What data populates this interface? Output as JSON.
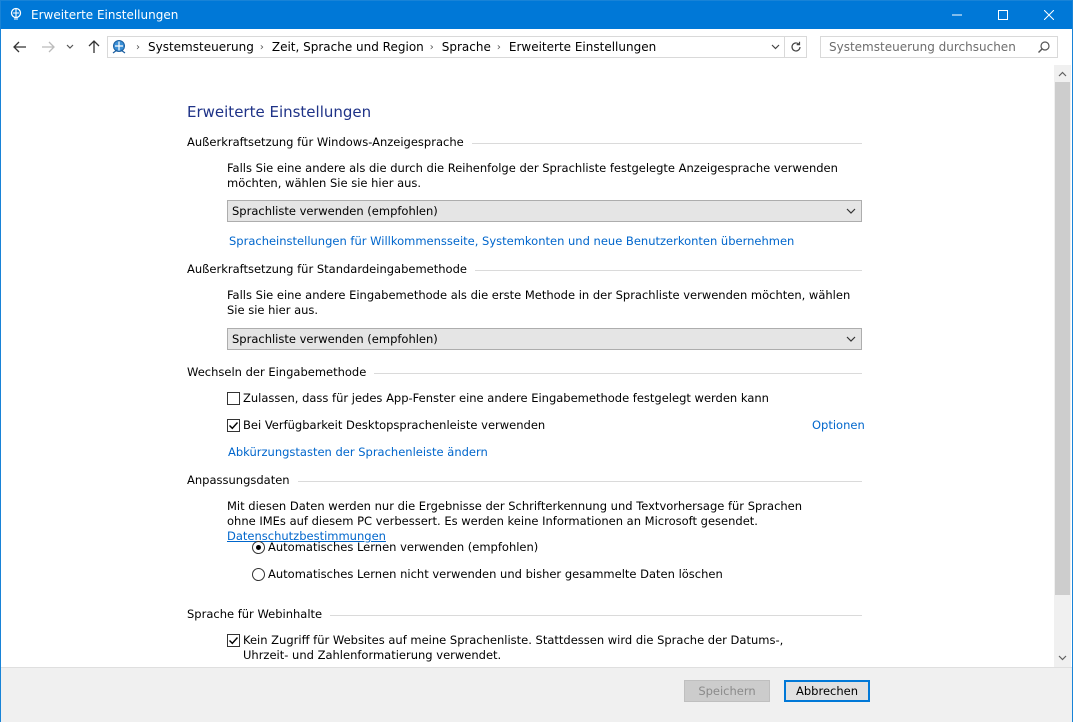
{
  "window": {
    "title": "Erweiterte Einstellungen"
  },
  "address": {
    "breadcrumbs": [
      "Systemsteuerung",
      "Zeit, Sprache und Region",
      "Sprache",
      "Erweiterte Einstellungen"
    ]
  },
  "search": {
    "placeholder": "Systemsteuerung durchsuchen"
  },
  "page": {
    "title": "Erweiterte Einstellungen"
  },
  "display_language": {
    "heading": "Außerkraftsetzung für Windows-Anzeigesprache",
    "description": "Falls Sie eine andere als die durch die Reihenfolge der Sprachliste festgelegte Anzeigesprache verwenden möchten, wählen Sie sie hier aus.",
    "selected": "Sprachliste verwenden (empfohlen)",
    "link": "Spracheinstellungen für Willkommensseite, Systemkonten und neue Benutzerkonten übernehmen"
  },
  "input_method": {
    "heading": "Außerkraftsetzung für Standardeingabemethode",
    "description": "Falls Sie eine andere Eingabemethode als die erste Methode in der Sprachliste verwenden möchten, wählen Sie sie hier aus.",
    "selected": "Sprachliste verwenden (empfohlen)"
  },
  "switching": {
    "heading": "Wechseln der Eingabemethode",
    "per_app_label": "Zulassen, dass für jedes App-Fenster eine andere Eingabemethode festgelegt werden kann",
    "per_app_checked": false,
    "desktop_bar_label": "Bei Verfügbarkeit Desktopsprachenleiste verwenden",
    "desktop_bar_checked": true,
    "options_link": "Optionen",
    "hotkeys_link": "Abkürzungstasten der Sprachenleiste ändern"
  },
  "personalization": {
    "heading": "Anpassungsdaten",
    "description": "Mit diesen Daten werden nur die Ergebnisse der Schrifterkennung und Textvorhersage für Sprachen ohne IMEs auf diesem PC verbessert. Es werden keine Informationen an Microsoft gesendet.",
    "privacy_link": "Datenschutzbestimmungen",
    "radio_use": "Automatisches Lernen verwenden (empfohlen)",
    "radio_dont_use": "Automatisches Lernen nicht verwenden und bisher gesammelte Daten löschen",
    "selected": "use"
  },
  "web_content": {
    "heading": "Sprache für Webinhalte",
    "label": "Kein Zugriff für Websites auf meine Sprachenliste. Stattdessen wird die Sprache der Datums-, Uhrzeit- und Zahlenformatierung verwendet.",
    "checked": true
  },
  "footer": {
    "save_label": "Speichern",
    "cancel_label": "Abbrechen"
  },
  "colors": {
    "titlebar": "#0078d7",
    "link": "#0066cc",
    "page_title": "#1e3287"
  },
  "icons": [
    "control-panel-icon",
    "back-arrow-icon",
    "forward-arrow-icon",
    "recent-dropdown-icon",
    "up-arrow-icon",
    "refresh-icon",
    "search-icon",
    "chevron-down-icon",
    "minimize-icon",
    "maximize-icon",
    "close-icon"
  ]
}
